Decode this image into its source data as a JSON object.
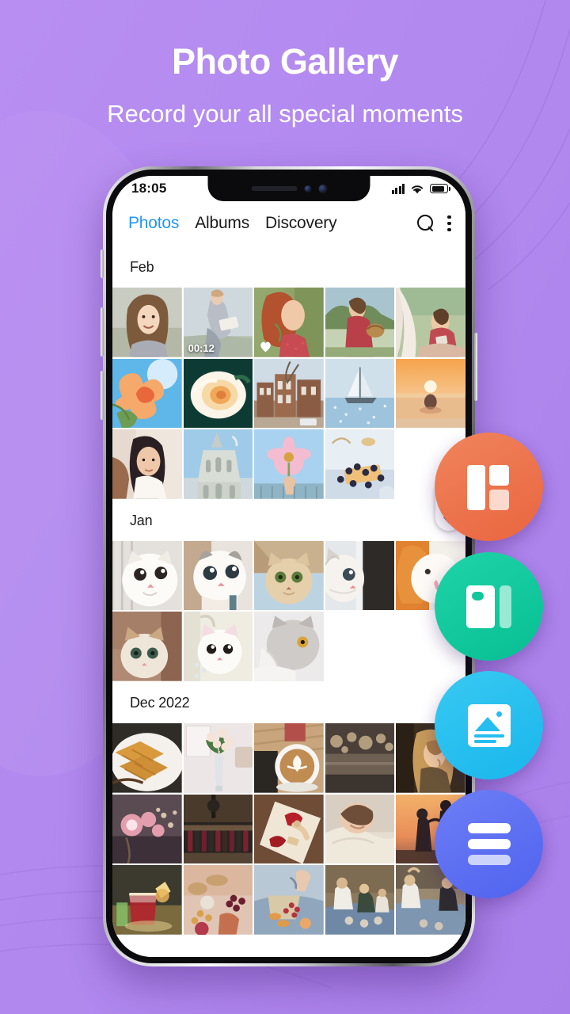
{
  "page": {
    "title": "Photo Gallery",
    "subtitle": "Record your all special moments",
    "background_color": "#b289ef",
    "title_color": "#ffffff"
  },
  "phone": {
    "status_bar": {
      "time": "18:05",
      "signal_icon": "cellular-signal-icon",
      "wifi_icon": "wifi-icon",
      "battery_icon": "battery-icon"
    }
  },
  "app": {
    "tabs": [
      {
        "label": "Photos",
        "active": true
      },
      {
        "label": "Albums",
        "active": false
      },
      {
        "label": "Discovery",
        "active": false
      }
    ],
    "active_tab_color": "#2196f3",
    "actions": [
      {
        "icon": "search-icon",
        "label": "Search"
      },
      {
        "icon": "more-vertical-icon",
        "label": "More options"
      }
    ],
    "sections": [
      {
        "header": "Feb",
        "items": [
          {
            "kind": "photo",
            "caption": "Smiling woman in field"
          },
          {
            "kind": "video",
            "duration": "00:12",
            "caption": "Woman sitting reading"
          },
          {
            "kind": "photo",
            "favorite": true,
            "caption": "Red haired woman with flower"
          },
          {
            "kind": "photo",
            "caption": "Woman with basket in meadow"
          },
          {
            "kind": "photo",
            "caption": "Woman under canopy tent"
          },
          {
            "kind": "photo",
            "caption": "Orange hibiscus flower sky"
          },
          {
            "kind": "photo",
            "caption": "Yellow rose with dew"
          },
          {
            "kind": "photo",
            "caption": "Brick townhouses street"
          },
          {
            "kind": "photo",
            "caption": "Sailboat on sparkling sea"
          },
          {
            "kind": "photo",
            "caption": "Sunset over ocean"
          },
          {
            "kind": "photo",
            "caption": "Woman with dark hair portrait"
          },
          {
            "kind": "photo",
            "caption": "Gothic cathedral facade"
          },
          {
            "kind": "photo",
            "caption": "Pink cosmos flower in hand"
          },
          {
            "kind": "photo",
            "caption": "Blueberry tart dessert"
          }
        ]
      },
      {
        "header": "Jan",
        "items": [
          {
            "kind": "photo",
            "caption": "White kitten looking up"
          },
          {
            "kind": "photo",
            "caption": "Grey and white kitten"
          },
          {
            "kind": "photo",
            "caption": "Cream British shorthair cat"
          },
          {
            "kind": "photo",
            "caption": "Cat peeking past dark wall"
          },
          {
            "kind": "photo",
            "caption": "Ginger cat licking"
          },
          {
            "kind": "photo",
            "caption": "Tabby kitten indoors"
          },
          {
            "kind": "photo",
            "caption": "White kitten on chair"
          },
          {
            "kind": "photo",
            "caption": "Grey cat resting"
          }
        ]
      },
      {
        "header": "Dec 2022",
        "items": [
          {
            "kind": "photo",
            "caption": "Waffles on plate"
          },
          {
            "kind": "photo",
            "caption": "Roses in glass vase"
          },
          {
            "kind": "photo",
            "caption": "Latte art heart coffee"
          },
          {
            "kind": "photo",
            "caption": "Bokeh lights cafe"
          },
          {
            "kind": "photo",
            "caption": "Woman profile golden light"
          },
          {
            "kind": "photo",
            "caption": "Pink flowers bokeh"
          },
          {
            "kind": "photo",
            "caption": "Wine bottles in bar"
          },
          {
            "kind": "photo",
            "caption": "Rose petals and letter"
          },
          {
            "kind": "photo",
            "caption": "Sleeping child in blanket"
          },
          {
            "kind": "photo",
            "caption": "Couple silhouette at sunset"
          },
          {
            "kind": "photo",
            "caption": "Cocktail glasses with citrus"
          },
          {
            "kind": "photo",
            "caption": "Grazing board with fruit"
          },
          {
            "kind": "photo",
            "caption": "Picnic spread on blanket"
          },
          {
            "kind": "photo",
            "caption": "Friends picnic outdoors"
          },
          {
            "kind": "photo",
            "caption": "Friends celebrating on blanket"
          }
        ]
      }
    ],
    "scrollbar": {
      "up_icon": "triangle-up-icon",
      "down_icon": "triangle-down-icon"
    }
  },
  "fabs": [
    {
      "name": "grid-layout",
      "icon": "grid-layout-icon",
      "color": "#e9653f"
    },
    {
      "name": "split-view",
      "icon": "split-view-icon",
      "color": "#07bf94"
    },
    {
      "name": "photo-card",
      "icon": "photo-card-icon",
      "color": "#19b6ec"
    },
    {
      "name": "menu-list",
      "icon": "menu-list-icon",
      "color": "#4f63ef"
    }
  ]
}
